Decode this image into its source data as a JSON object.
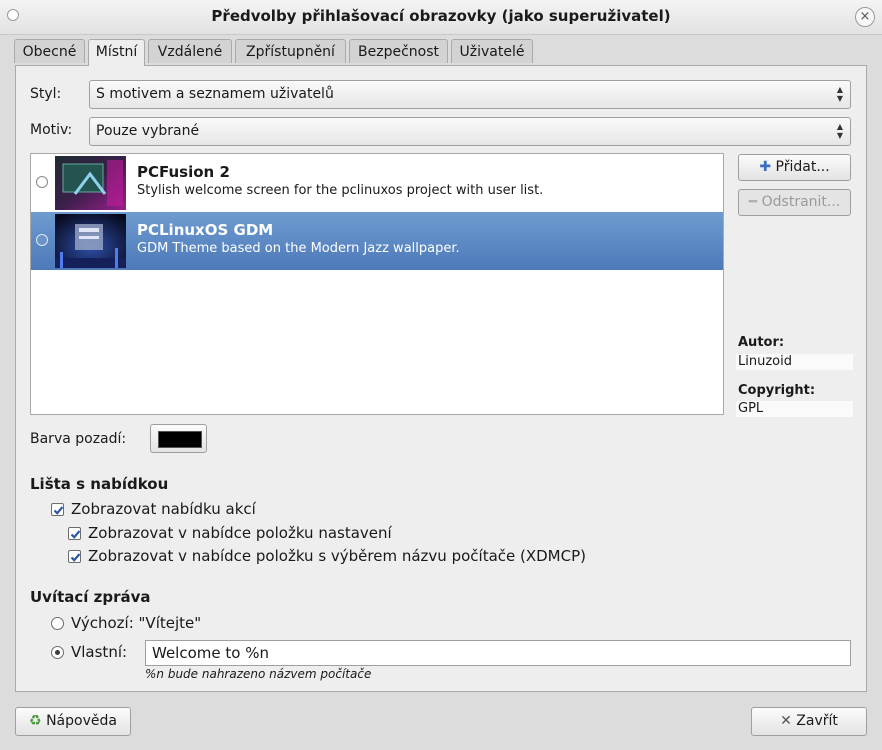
{
  "window": {
    "title": "Předvolby přihlašovací obrazovky (jako superuživatel)"
  },
  "tabs": [
    {
      "label": "Obecné",
      "active": false
    },
    {
      "label": "Místní",
      "active": true
    },
    {
      "label": "Vzdálené",
      "active": false
    },
    {
      "label": "Zpřístupnění",
      "active": false
    },
    {
      "label": "Bezpečnost",
      "active": false
    },
    {
      "label": "Uživatelé",
      "active": false
    }
  ],
  "style": {
    "label": "Styl:",
    "value": "S motivem a seznamem uživatelů"
  },
  "theme_mode": {
    "label": "Motiv:",
    "value": "Pouze vybrané"
  },
  "themes": [
    {
      "name": "PCFusion 2",
      "description": "Stylish welcome screen for the pclinuxos project with user list.",
      "selected": false
    },
    {
      "name": "PCLinuxOS GDM",
      "description": "GDM Theme based on the Modern Jazz wallpaper.",
      "selected": true
    }
  ],
  "buttons": {
    "add": "Přidat...",
    "remove": "Odstranit...",
    "help": "Nápověda",
    "close": "Zavřít"
  },
  "info": {
    "author_label": "Autor:",
    "author": "Linuzoid",
    "copyright_label": "Copyright:",
    "copyright": "GPL"
  },
  "background": {
    "label": "Barva pozadí:",
    "color": "#000000"
  },
  "menubar": {
    "title": "Lišta s nabídkou",
    "show_actions": {
      "label": "Zobrazovat nabídku akcí",
      "checked": true
    },
    "show_config": {
      "label": "Zobrazovat v nabídce položku nastavení",
      "checked": true
    },
    "show_xdmcp": {
      "label": "Zobrazovat v nabídce položku s výběrem názvu počítače (XDMCP)",
      "checked": true
    }
  },
  "welcome": {
    "title": "Uvítací zpráva",
    "default_label": "Výchozí: \"Vítejte\"",
    "custom_label": "Vlastní:",
    "custom_value": "Welcome to %n",
    "hint": "%n bude nahrazeno názvem počítače",
    "selected": "custom"
  },
  "colors": {
    "selection": "#5b87c2",
    "panel": "#eeeeee"
  }
}
